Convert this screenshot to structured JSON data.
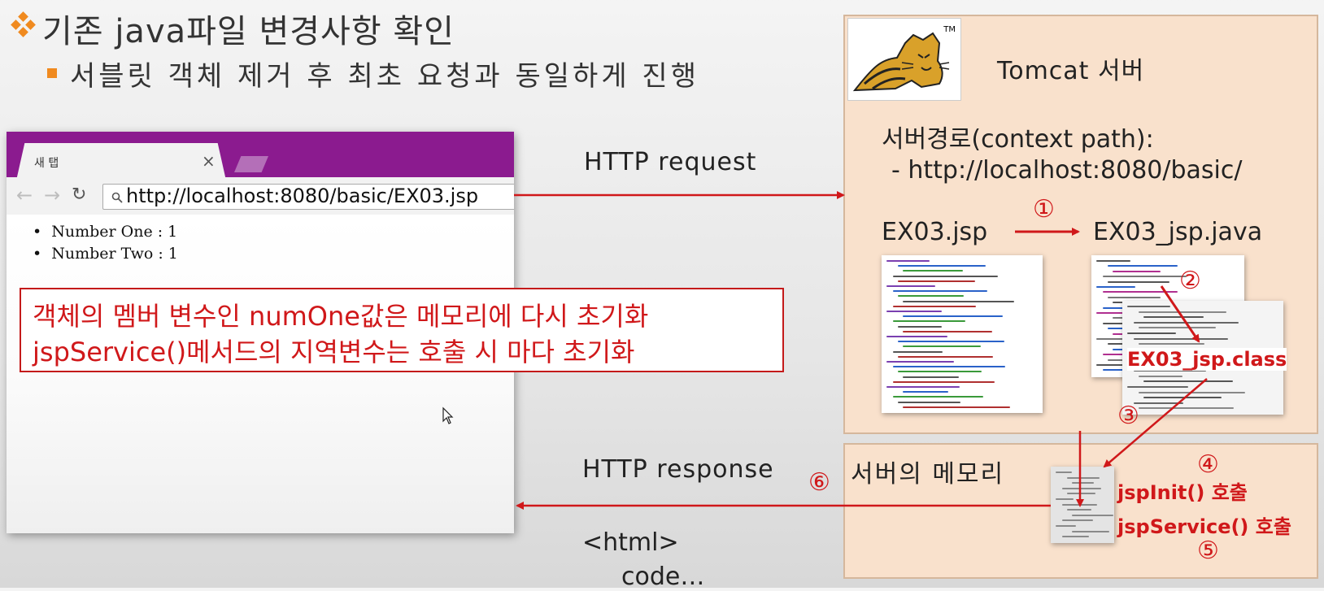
{
  "title": "기존 java파일 변경사항 확인",
  "subtitle": "서블릿 객체 제거 후 최초 요청과 동일하게 진행",
  "browser": {
    "tab_label": "새 탭",
    "tab_close": "×",
    "url": "http://localhost:8080/basic/EX03.jsp",
    "list": [
      "Number One : 1",
      "Number Two : 1"
    ]
  },
  "note": {
    "line1": "객체의 멤버 변수인 numOne값은 메모리에 다시 초기화",
    "line2": "jspService()메서드의 지역변수는 호출 시 마다 초기화"
  },
  "http_request": "HTTP request",
  "http_response": "HTTP response",
  "response_body": {
    "line1": "<html>",
    "line2": "code…"
  },
  "tomcat": {
    "server_label": "Tomcat 서버",
    "context_label": "서버경로(context path):",
    "context_value": "- http://localhost:8080/basic/",
    "jsp_file": "EX03.jsp",
    "java_file": "EX03_jsp.java",
    "class_file": "EX03_jsp.class",
    "tm": "TM"
  },
  "memory": {
    "label": "서버의 메모리",
    "init_call": "jspInit() 호출",
    "service_call": "jspService() 호출"
  },
  "steps": [
    "①",
    "②",
    "③",
    "④",
    "⑤",
    "⑥"
  ],
  "colors": {
    "accent_red": "#d0181a",
    "browser_purple": "#8b1b8f",
    "panel_bg": "#f9e1cc",
    "bullet_orange": "#f08a1f"
  }
}
